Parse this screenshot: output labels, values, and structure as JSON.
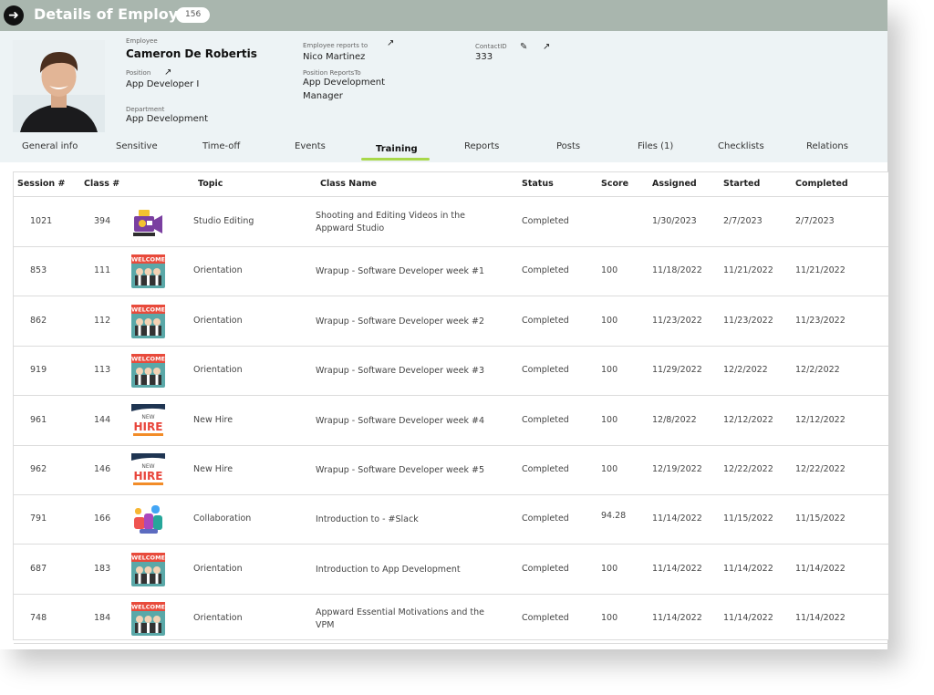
{
  "header": {
    "title": "Details of Employee",
    "count": "156"
  },
  "employee": {
    "name_label": "Employee",
    "name": "Cameron De Robertis",
    "position_label": "Position",
    "position": "App Developer I",
    "department_label": "Department",
    "department": "App Development",
    "reports_to_label": "Employee reports to",
    "reports_to": "Nico Martinez",
    "position_reports_to_label": "Position ReportsTo",
    "position_reports_to_line1": "App Development",
    "position_reports_to_line2": "Manager",
    "contact_label": "ContactID",
    "contact_id": "333"
  },
  "tabs": [
    {
      "label": "General info"
    },
    {
      "label": "Sensitive"
    },
    {
      "label": "Time-off"
    },
    {
      "label": "Events"
    },
    {
      "label": "Training"
    },
    {
      "label": "Reports"
    },
    {
      "label": "Posts"
    },
    {
      "label": "Files (1)"
    },
    {
      "label": "Checklists"
    },
    {
      "label": "Relations"
    }
  ],
  "active_tab": "Training",
  "table": {
    "columns": [
      "Session #",
      "Class #",
      "Topic",
      "Class Name",
      "Status",
      "Score",
      "Assigned",
      "Started",
      "Completed"
    ],
    "rows": [
      {
        "session": "1021",
        "class_no": "394",
        "icon": "video-camera",
        "topic": "Studio Editing",
        "name_line1": "Shooting and Editing Videos in the",
        "name_line2": "Appward Studio",
        "status": "Completed",
        "score": "",
        "assigned": "1/30/2023",
        "started": "2/7/2023",
        "completed": "2/7/2023"
      },
      {
        "session": "853",
        "class_no": "111",
        "icon": "welcome",
        "topic": "Orientation",
        "name_line1": "Wrapup - Software Developer week #1",
        "name_line2": "",
        "status": "Completed",
        "score": "100",
        "assigned": "11/18/2022",
        "started": "11/21/2022",
        "completed": "11/21/2022"
      },
      {
        "session": "862",
        "class_no": "112",
        "icon": "welcome",
        "topic": "Orientation",
        "name_line1": "Wrapup - Software Developer week #2",
        "name_line2": "",
        "status": "Completed",
        "score": "100",
        "assigned": "11/23/2022",
        "started": "11/23/2022",
        "completed": "11/23/2022"
      },
      {
        "session": "919",
        "class_no": "113",
        "icon": "welcome",
        "topic": "Orientation",
        "name_line1": "Wrapup - Software Developer week #3",
        "name_line2": "",
        "status": "Completed",
        "score": "100",
        "assigned": "11/29/2022",
        "started": "12/2/2022",
        "completed": "12/2/2022"
      },
      {
        "session": "961",
        "class_no": "144",
        "icon": "new-hire",
        "topic": "New Hire",
        "name_line1": "Wrapup - Software Developer week #4",
        "name_line2": "",
        "status": "Completed",
        "score": "100",
        "assigned": "12/8/2022",
        "started": "12/12/2022",
        "completed": "12/12/2022"
      },
      {
        "session": "962",
        "class_no": "146",
        "icon": "new-hire",
        "topic": "New Hire",
        "name_line1": "Wrapup - Software Developer week #5",
        "name_line2": "",
        "status": "Completed",
        "score": "100",
        "assigned": "12/19/2022",
        "started": "12/22/2022",
        "completed": "12/22/2022"
      },
      {
        "session": "791",
        "class_no": "166",
        "icon": "collaboration",
        "topic": "Collaboration",
        "name_line1": "Introduction to - #Slack",
        "name_line2": "",
        "status": "Completed",
        "score": "94.28",
        "assigned": "11/14/2022",
        "started": "11/15/2022",
        "completed": "11/15/2022"
      },
      {
        "session": "687",
        "class_no": "183",
        "icon": "welcome",
        "topic": "Orientation",
        "name_line1": "Introduction to App Development",
        "name_line2": "",
        "status": "Completed",
        "score": "100",
        "assigned": "11/14/2022",
        "started": "11/14/2022",
        "completed": "11/14/2022"
      },
      {
        "session": "748",
        "class_no": "184",
        "icon": "welcome",
        "topic": "Orientation",
        "name_line1": "Appward Essential Motivations and the",
        "name_line2": "VPM",
        "status": "Completed",
        "score": "100",
        "assigned": "11/14/2022",
        "started": "11/14/2022",
        "completed": "11/14/2022"
      }
    ]
  },
  "thumb_text": {
    "welcome": "WELCOME",
    "new_hire_small": "NEW",
    "new_hire_big": "HIRE"
  },
  "colors": {
    "title_bar": "#a9b6ae",
    "header_bg": "#edf3f5",
    "tab_underline": "#a8d84a"
  }
}
